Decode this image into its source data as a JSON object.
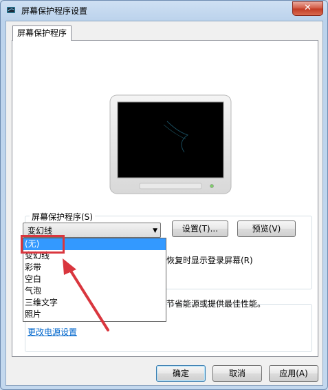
{
  "window": {
    "title": "屏幕保护程序设置",
    "close_glyph": "✕"
  },
  "tabs": [
    {
      "label": "屏幕保护程序"
    }
  ],
  "screensaver": {
    "group_label": "屏幕保护程序(S)",
    "selected": "变幻线",
    "settings_label": "设置(T)...",
    "preview_label": "预览(V)",
    "resume_text_partial": "恢复时显示登录屏幕(R)",
    "options": [
      "(无)",
      "变幻线",
      "彩带",
      "空白",
      "气泡",
      "三维文字",
      "照片"
    ],
    "highlighted_option": "(无)"
  },
  "power": {
    "text_partial": "节省能源或提供最佳性能。",
    "link": "更改电源设置"
  },
  "footer": {
    "ok_label": "确定",
    "cancel_label": "取消",
    "apply_label": "应用(A)"
  },
  "colors": {
    "selection": "#3399ff",
    "annotation": "#d9363e",
    "link": "#0066cc"
  },
  "icons": [
    "screensaver-app-icon",
    "close-icon",
    "monitor-image",
    "dropdown-arrow-icon",
    "annotation-arrow"
  ]
}
